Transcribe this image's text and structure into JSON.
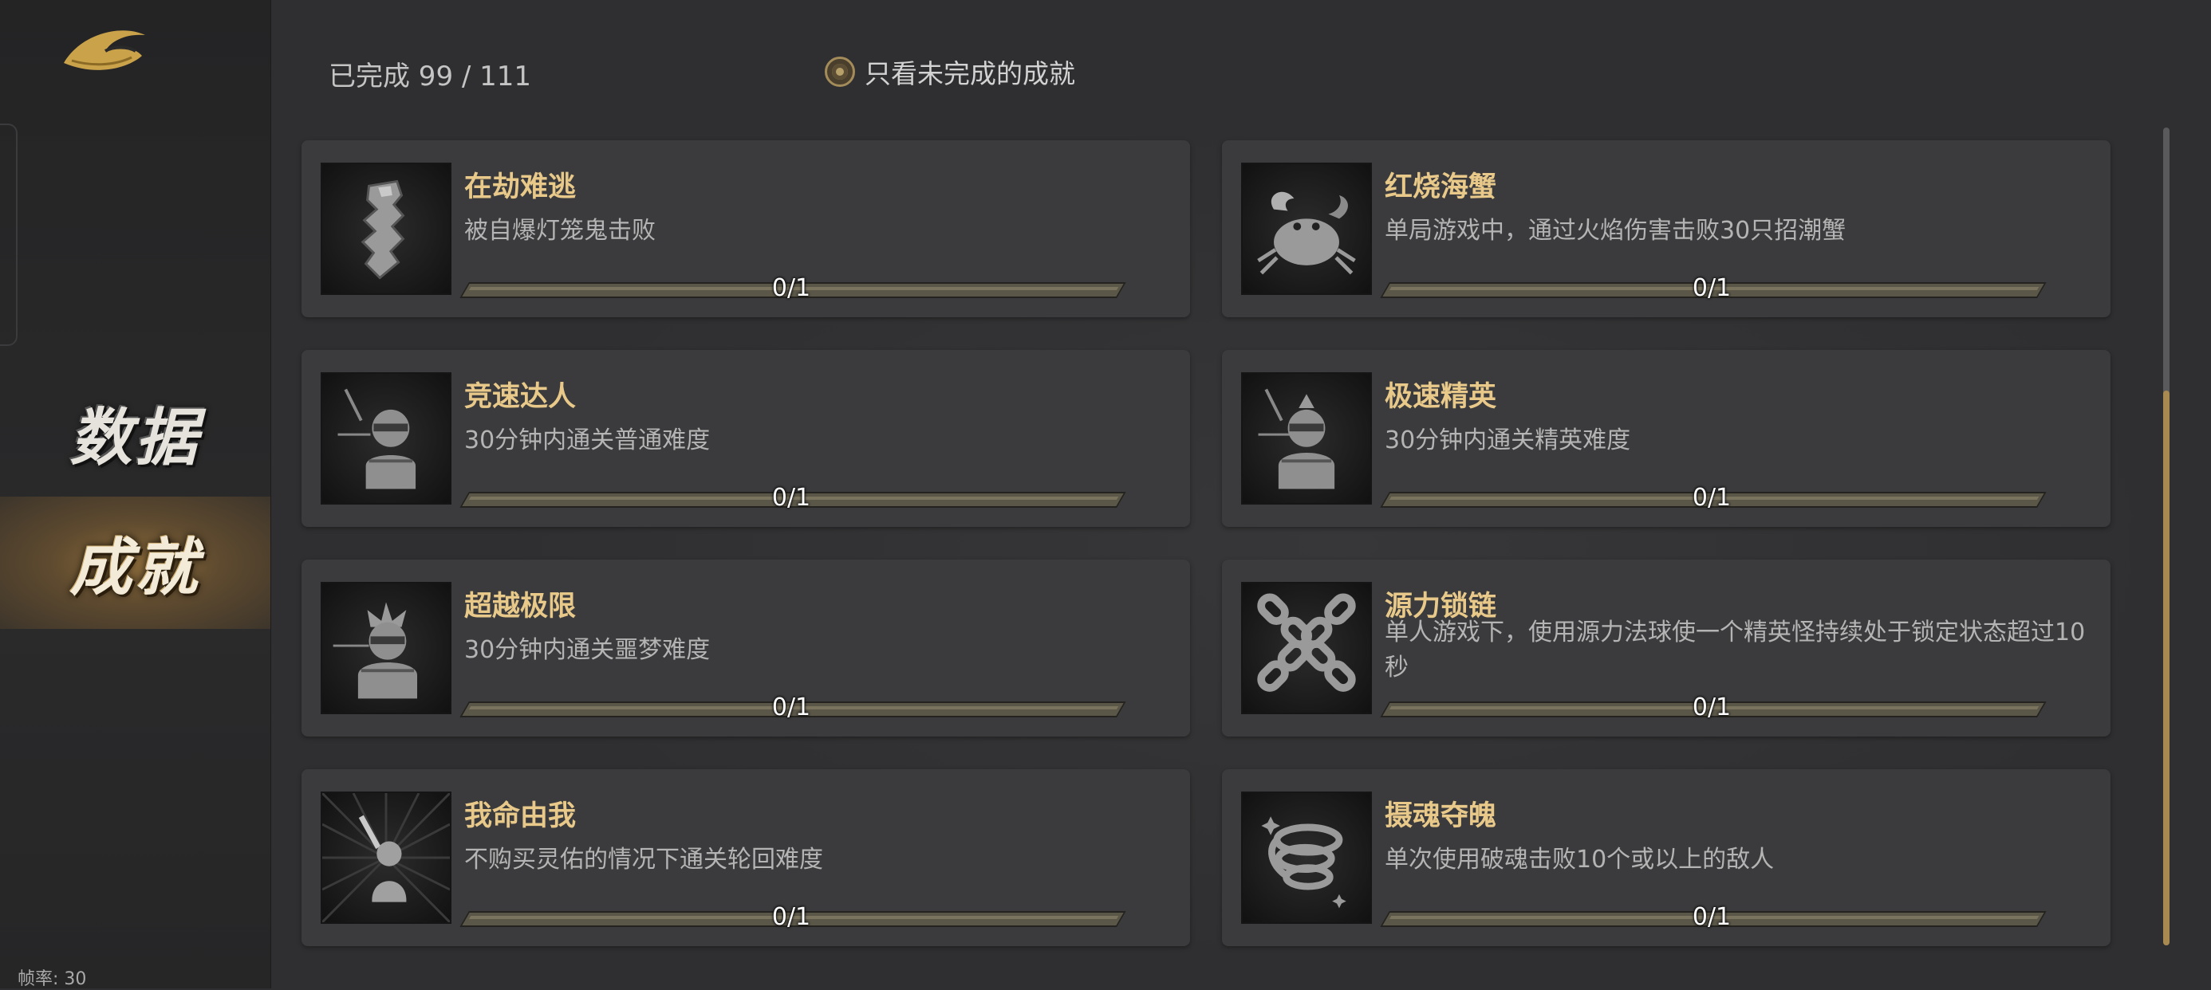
{
  "sidebar": {
    "nav_items": [
      {
        "label": "数据",
        "selected": false
      },
      {
        "label": "成就",
        "selected": true
      }
    ],
    "fps_label": "帧率: 30",
    "logo": "dragon-swoosh-logo"
  },
  "header": {
    "progress": "已完成 99 / 111",
    "filter_label": "只看未完成的成就",
    "filter_checked": true
  },
  "achievements": [
    {
      "title": "在劫难逃",
      "desc": "被自爆灯笼鬼击败",
      "progress": "0/1",
      "fraction": 0,
      "icon": "lantern-ghost-icon"
    },
    {
      "title": "红烧海蟹",
      "desc": "单局游戏中，通过火焰伤害击败30只招潮蟹",
      "progress": "0/1",
      "fraction": 0,
      "icon": "crab-icon"
    },
    {
      "title": "竞速达人",
      "desc": "30分钟内通关普通难度",
      "progress": "0/1",
      "fraction": 0,
      "icon": "speed-hero-icon"
    },
    {
      "title": "极速精英",
      "desc": "30分钟内通关精英难度",
      "progress": "0/1",
      "fraction": 0,
      "icon": "elite-hero-icon"
    },
    {
      "title": "超越极限",
      "desc": "30分钟内通关噩梦难度",
      "progress": "0/1",
      "fraction": 0,
      "icon": "nightmare-hero-icon"
    },
    {
      "title": "源力锁链",
      "desc": "单人游戏下，使用源力法球使一个精英怪持续处于锁定状态超过10秒",
      "progress": "0/1",
      "fraction": 0,
      "icon": "chain-icon"
    },
    {
      "title": "我命由我",
      "desc": "不购买灵佑的情况下通关轮回难度",
      "progress": "0/1",
      "fraction": 0,
      "icon": "sword-figure-icon"
    },
    {
      "title": "摄魂夺魄",
      "desc": "单次使用破魂击败10个或以上的敌人",
      "progress": "0/1",
      "fraction": 0,
      "icon": "soul-vortex-icon"
    }
  ],
  "scrollbar": {
    "position_fraction": 0.32
  }
}
